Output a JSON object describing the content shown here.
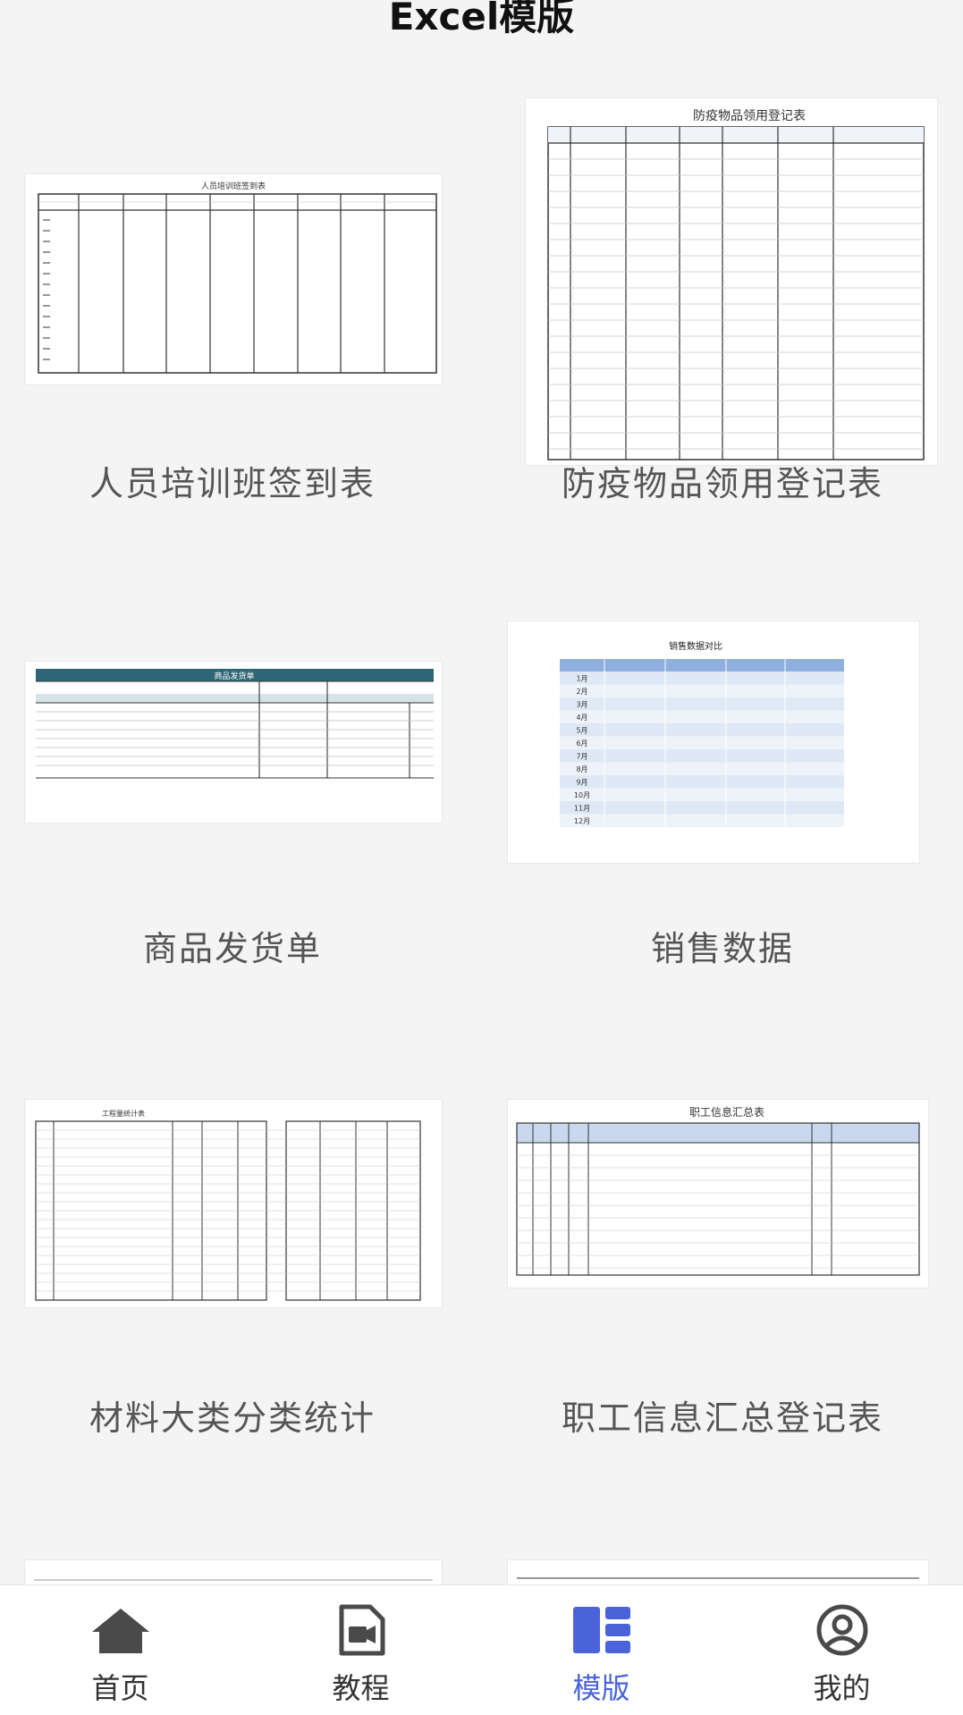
{
  "header": {
    "title": "Excel模版"
  },
  "templates": [
    {
      "label": "人员培训班签到表",
      "sheet_title": "人员培训班签到表"
    },
    {
      "label": "防疫物品领用登记表",
      "sheet_title": "防疫物品领用登记表"
    },
    {
      "label": "商品发货单",
      "sheet_title": "商品发货单"
    },
    {
      "label": "销售数据",
      "sheet_title": "销售数据对比"
    },
    {
      "label": "材料大类分类统计",
      "sheet_title": "工程量统计表"
    },
    {
      "label": "职工信息汇总登记表",
      "sheet_title": "职工信息汇总表"
    }
  ],
  "sales_months": [
    "1月",
    "2月",
    "3月",
    "4月",
    "5月",
    "6月",
    "7月",
    "8月",
    "9月",
    "10月",
    "11月",
    "12月"
  ],
  "nav": [
    {
      "label": "首页",
      "icon": "home-icon",
      "active": false
    },
    {
      "label": "教程",
      "icon": "video-doc-icon",
      "active": false
    },
    {
      "label": "模版",
      "icon": "template-icon",
      "active": true
    },
    {
      "label": "我的",
      "icon": "user-icon",
      "active": false
    }
  ],
  "colors": {
    "accent": "#4b63d8",
    "sheet_header_teal": "#2e6677",
    "sheet_header_blue": "#8fb0de"
  }
}
